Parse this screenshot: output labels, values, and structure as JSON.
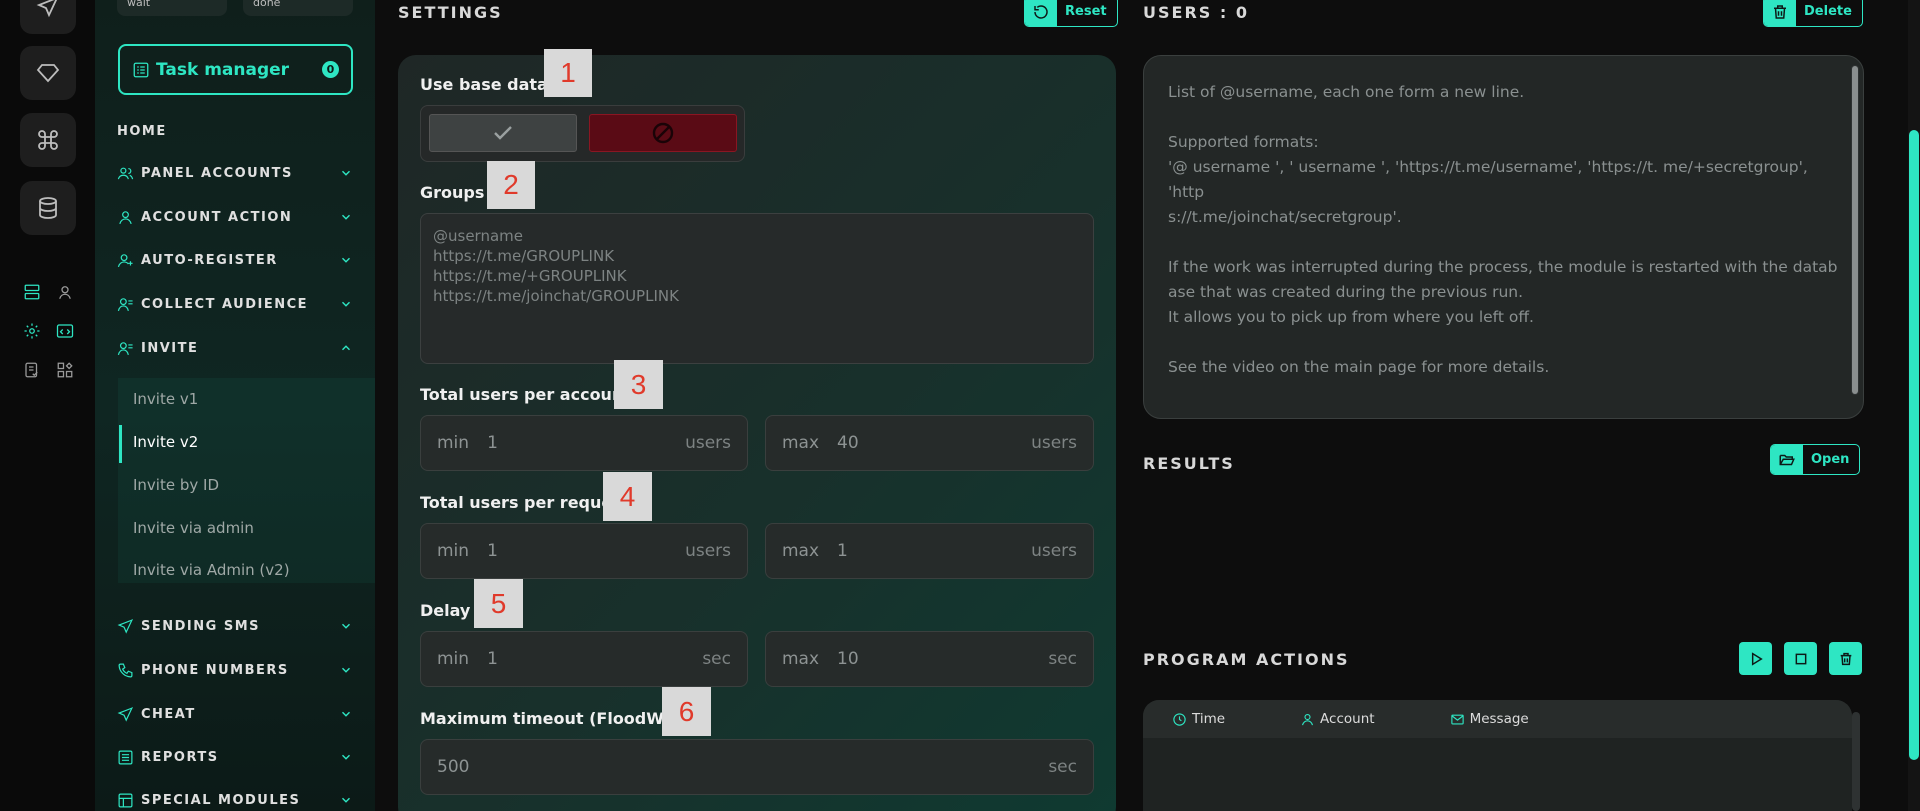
{
  "sidebar": {
    "stat_wait": "wait",
    "stat_done": "done",
    "task_manager": "Task manager",
    "task_count": "0",
    "home": "HOME",
    "items": [
      {
        "label": "PANEL ACCOUNTS"
      },
      {
        "label": "ACCOUNT ACTION"
      },
      {
        "label": "AUTO-REGISTER"
      },
      {
        "label": "COLLECT AUDIENCE"
      },
      {
        "label": "INVITE"
      },
      {
        "label": "SENDING SMS"
      },
      {
        "label": "PHONE NUMBERS"
      },
      {
        "label": "CHEAT"
      },
      {
        "label": "REPORTS"
      },
      {
        "label": "SPECIAL MODULES"
      }
    ],
    "sub_items": [
      "Invite v1",
      "Invite v2",
      "Invite by ID",
      "Invite via admin",
      "Invite via Admin (v2)"
    ]
  },
  "settings": {
    "title": "SETTINGS",
    "reset": "Reset",
    "use_base_data": "Use base data",
    "groups": "Groups",
    "groups_placeholder": [
      "@username",
      "https://t.me/GROUPLINK",
      "https://t.me/+GROUPLINK",
      "https://t.me/joinchat/GROUPLINK"
    ],
    "total_users_per_account": "Total users per account",
    "total_users_per_request": "Total users per request",
    "delay": "Delay",
    "max_timeout": "Maximum timeout (FloodWait)",
    "min": "min",
    "max": "max",
    "users": "users",
    "sec": "sec",
    "tua_min": "1",
    "tua_max": "40",
    "tur_min": "1",
    "tur_max": "1",
    "delay_min": "1",
    "delay_max": "10",
    "timeout": "500"
  },
  "tags": [
    "1",
    "2",
    "3",
    "4",
    "5",
    "6"
  ],
  "users": {
    "title": "USERS : 0",
    "delete": "Delete",
    "help": [
      "List of @username, each one form a new line.",
      "",
      "Supported formats:",
      "'@ username ', ' username ', 'https://t.me/username', 'https://t. me/+secretgroup', 'http",
      "s://t.me/joinchat/secretgroup'.",
      "",
      "If the work was interrupted during the process, the module is restarted with the datab",
      "ase that was created during the previous run.",
      "It allows you to pick up from where you left off.",
      "",
      "See the video on the main page for more details."
    ]
  },
  "results": {
    "title": "RESULTS",
    "open": "Open"
  },
  "program_actions": {
    "title": "PROGRAM ACTIONS",
    "columns": [
      "Time",
      "Account",
      "Message"
    ]
  },
  "colors": {
    "accent": "#2ee6c3",
    "danger": "#5a0b15",
    "tag_text": "#e03a2b"
  }
}
